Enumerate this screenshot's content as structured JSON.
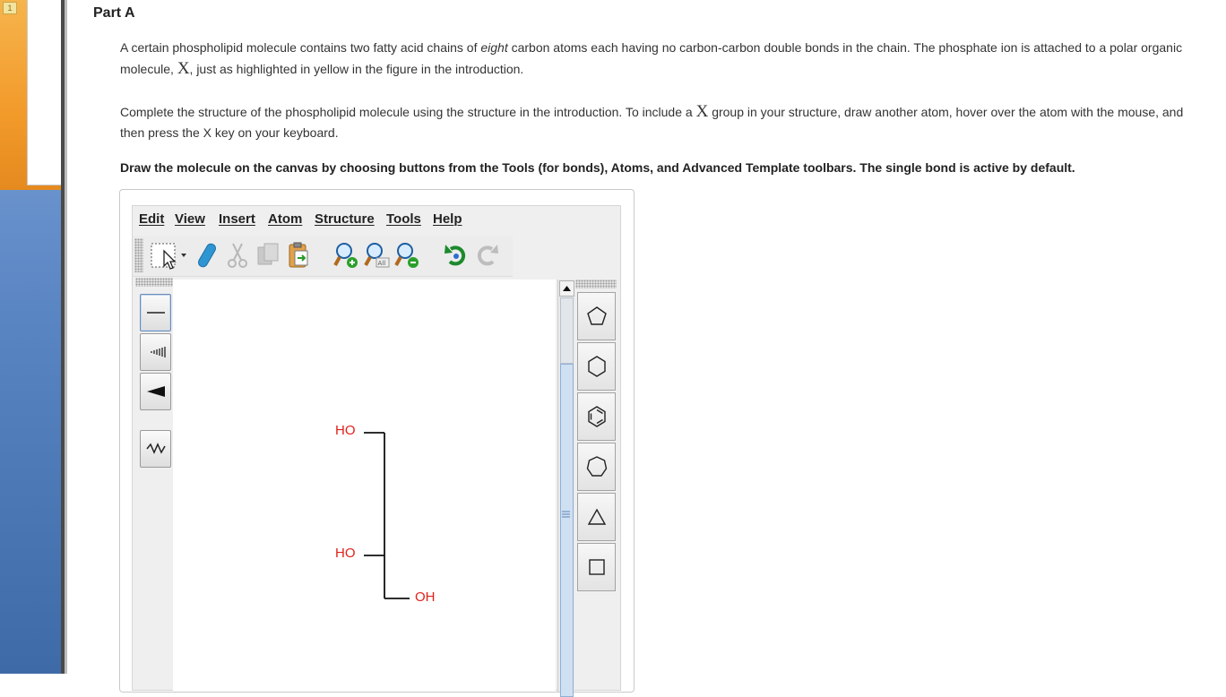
{
  "sidebar": {
    "tab_badge": "1"
  },
  "part": {
    "title": "Part A"
  },
  "question": {
    "p1_a": "A certain phospholipid molecule contains two fatty acid chains of ",
    "p1_em": "eight",
    "p1_b": " carbon atoms each having no carbon-carbon double bonds in the chain. The phosphate ion is attached to a polar organic molecule, ",
    "p1_x": "X",
    "p1_c": ", just as highlighted in yellow in the figure in the introduction.",
    "p2_a": "Complete the structure of the phospholipid molecule using the structure in the introduction. To include a ",
    "p2_x": "X",
    "p2_b": " group in your structure, draw another atom, hover over the atom with the mouse, and then press the X key on your keyboard.",
    "p3": "Draw the molecule on the canvas by choosing buttons from the Tools (for bonds), Atoms, and Advanced Template toolbars. The single bond is active by default."
  },
  "editor": {
    "menu": [
      "Edit",
      "View",
      "Insert",
      "Atom",
      "Structure",
      "Tools",
      "Help"
    ],
    "toolbar_icons": [
      "select-lasso-icon",
      "eraser-icon",
      "cut-icon",
      "copy-icon",
      "paste-icon",
      "zoom-in-icon",
      "zoom-all-icon",
      "zoom-out-icon",
      "undo-icon",
      "redo-icon"
    ],
    "bond_tools": [
      "single-bond-icon",
      "hashed-wedge-bond-icon",
      "solid-wedge-bond-icon",
      "chain-tool-icon"
    ],
    "templates": [
      "cyclopentane-icon",
      "cyclohexane-icon",
      "benzene-icon",
      "cycloheptane-icon",
      "cyclopropane-icon",
      "cyclobutane-icon"
    ],
    "molecule": {
      "labels": [
        "HO",
        "HO",
        "OH"
      ]
    },
    "colors": {
      "heteroatom": "#e0201b",
      "bond": "#111111"
    }
  }
}
